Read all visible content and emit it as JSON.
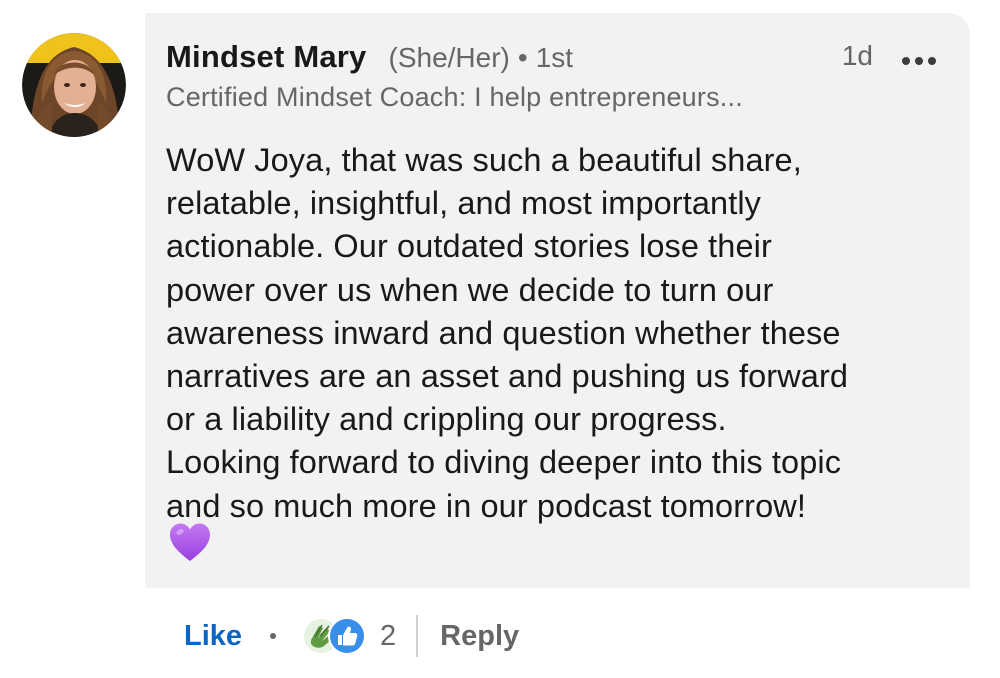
{
  "comment": {
    "author_name": "Mindset Mary",
    "pronouns": "(She/Her)",
    "separator": "•",
    "degree": "1st",
    "time_ago": "1d",
    "headline": "Certified Mindset Coach: I help entrepreneurs...",
    "text": "WoW Joya, that was such a beautiful share,\nrelatable, insightful, and most importantly\nactionable. Our outdated stories lose their\npower over us when we decide to turn our\nawareness inward and question whether these\nnarratives are an asset and pushing us forward\nor a liability and crippling our progress.\nLooking forward to diving deeper into this topic\nand so much more in our podcast tomorrow!",
    "emoji_icon": "purple-heart-icon"
  },
  "actions": {
    "like_label": "Like",
    "reaction_count": "2",
    "reaction_icons": [
      "clap-icon",
      "thumbs-up-icon"
    ],
    "reply_label": "Reply"
  },
  "colors": {
    "bubble_bg": "#f2f2f2",
    "link_blue": "#0a66c2",
    "secondary_text": "#666666",
    "primary_text": "#191919",
    "heart_purple": "#a54ee6"
  }
}
